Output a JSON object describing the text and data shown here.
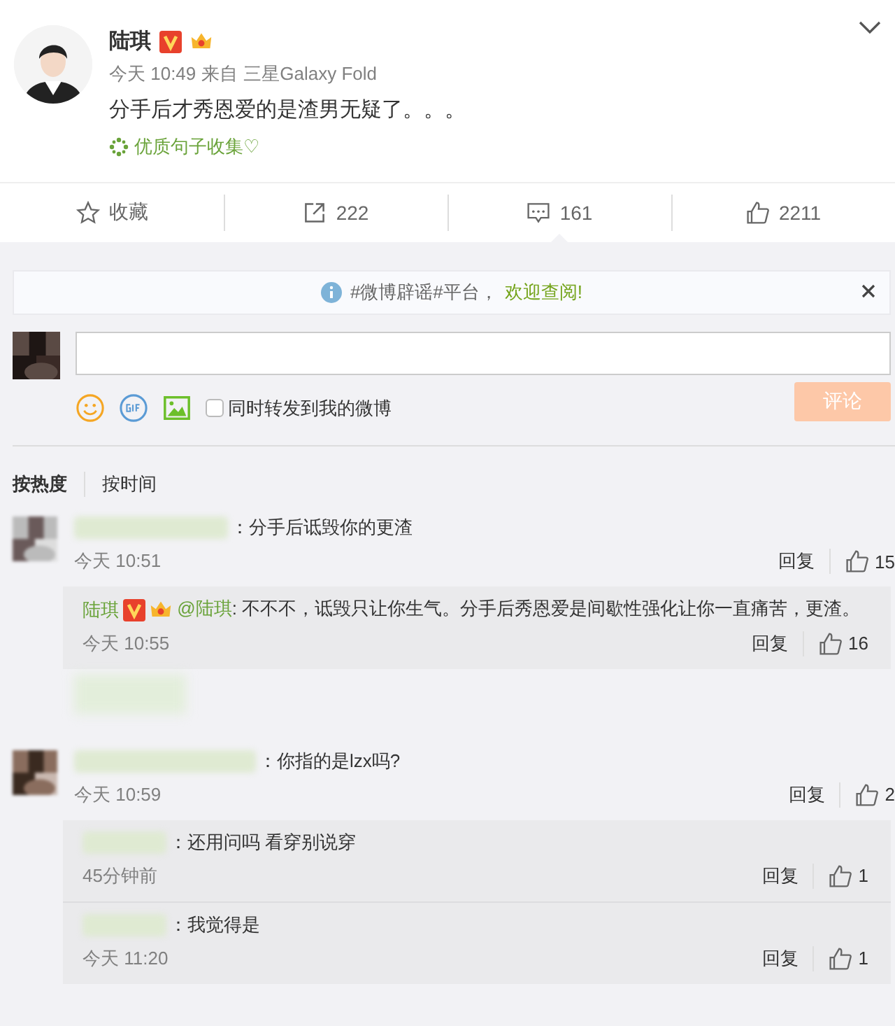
{
  "post": {
    "author": "陆琪",
    "time": "今天 10:49",
    "source_label": "来自",
    "source": "三星Galaxy Fold",
    "text": "分手后才秀恩爱的是渣男无疑了。。。",
    "topic": "优质句子收集♡"
  },
  "actions": [
    {
      "kind": "star",
      "label": "收藏"
    },
    {
      "kind": "share",
      "label": "222"
    },
    {
      "kind": "comment",
      "label": "161",
      "selected": true
    },
    {
      "kind": "like",
      "label": "2211"
    }
  ],
  "notice": {
    "text": "#微博辟谣#平台，",
    "link": "欢迎查阅!"
  },
  "composer": {
    "option": {
      "label": "同时转发到我的微博",
      "checked": false
    },
    "submit": {
      "label": "评论",
      "disabled": true
    }
  },
  "sort_tabs": [
    {
      "label": "按热度",
      "selected": true
    },
    {
      "label": "按时间",
      "selected": false
    }
  ],
  "comments": [
    {
      "text": "：分手后诋毁你的更渣",
      "time": "今天 10:51",
      "reply": "回复",
      "likes": "15",
      "replies": [
        {
          "author": "陆琪",
          "mention": "@陆琪",
          "text": ": 不不不，诋毁只让你生气。分手后秀恩爱是间歇性强化让你一直痛苦，更渣。",
          "time": "今天 10:55",
          "reply": "回复",
          "likes": "16"
        }
      ],
      "more_hidden": true
    },
    {
      "text": "：你指的是lzx吗?",
      "time": "今天 10:59",
      "reply": "回复",
      "likes": "2",
      "replies": [
        {
          "text": "：还用问吗 看穿别说穿",
          "time": "45分钟前",
          "reply": "回复",
          "likes": "1"
        },
        {
          "text": "：我觉得是",
          "time": "今天 11:20",
          "reply": "回复",
          "likes": "1"
        }
      ],
      "more_hidden": false
    }
  ]
}
